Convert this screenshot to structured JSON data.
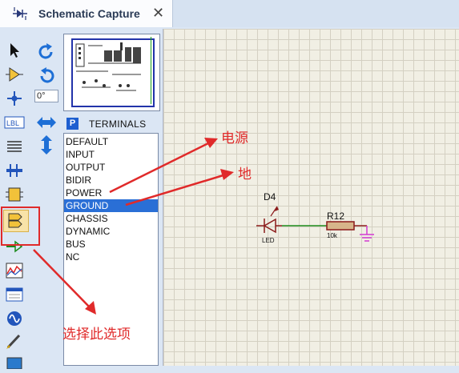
{
  "tab": {
    "title": "Schematic Capture",
    "close": "✕",
    "icon": "schematic-icon"
  },
  "rotation": {
    "angle": "0°"
  },
  "terminals": {
    "header_button": "P",
    "title": "TERMINALS",
    "items": [
      "DEFAULT",
      "INPUT",
      "OUTPUT",
      "BIDIR",
      "POWER",
      "GROUND",
      "CHASSIS",
      "DYNAMIC",
      "BUS",
      "NC"
    ],
    "selected": "GROUND"
  },
  "schematic": {
    "diode_ref": "D4",
    "diode_value": "LED",
    "resistor_ref": "R12",
    "resistor_value": "10k"
  },
  "annotations": {
    "power": "电源",
    "ground": "地",
    "select": "选择此选项"
  },
  "colors": {
    "annotation": "#e02a2a",
    "selection": "#2a6fd6",
    "wire": "#1a8a1a",
    "component": "#8b1a1a",
    "ground_symbol": "#d23ad2"
  }
}
